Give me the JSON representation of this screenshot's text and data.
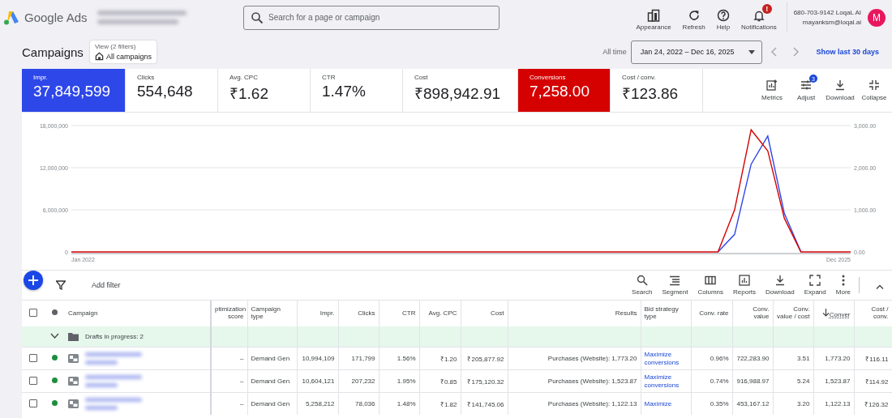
{
  "header": {
    "product": "Google Ads",
    "search": {
      "placeholder": "Search for a page or campaign"
    },
    "tools": [
      {
        "kind": "appearance",
        "label": "Appearance"
      },
      {
        "kind": "refresh",
        "label": "Refresh"
      },
      {
        "kind": "help",
        "label": "Help"
      },
      {
        "kind": "notifications",
        "label": "Notifications",
        "badge": "!"
      }
    ],
    "account": {
      "line1": "680-703-9142 LoqaL AI",
      "line2": "mayanksm@loqal.ai",
      "avatar": "M"
    }
  },
  "page": {
    "title": "Campaigns",
    "view": {
      "caption": "View (2 filters)",
      "value": "All campaigns"
    },
    "date": {
      "preset": "All time",
      "range": "Jan 24, 2022 – Dec 16, 2025",
      "link": "Show last 30 days"
    }
  },
  "metrics": [
    {
      "label": "Impr.",
      "value": "37,849,599",
      "selected": true,
      "color": "#2e47e8"
    },
    {
      "label": "Clicks",
      "value": "554,648",
      "selected": false
    },
    {
      "label": "Avg. CPC",
      "value": "₹1.62",
      "selected": false
    },
    {
      "label": "CTR",
      "value": "1.47%",
      "selected": false
    },
    {
      "label": "Cost",
      "value": "₹898,942.91",
      "selected": false
    },
    {
      "label": "Conversions",
      "value": "7,258.00",
      "selected": true,
      "color": "#d50000"
    },
    {
      "label": "Cost / conv.",
      "value": "₹123.86",
      "selected": false
    }
  ],
  "metric_tools": [
    {
      "kind": "metrics",
      "label": "Metrics"
    },
    {
      "kind": "adjust",
      "label": "Adjust",
      "badge": "3"
    },
    {
      "kind": "download",
      "label": "Download"
    },
    {
      "kind": "collapse",
      "label": "Collapse"
    }
  ],
  "chart_data": {
    "type": "line",
    "ylim": [
      0,
      18000000
    ],
    "y2lim": [
      0,
      3000
    ],
    "yticks": [
      {
        "value": 0,
        "label": "0"
      },
      {
        "value": 6000000,
        "label": "6,000,000"
      },
      {
        "value": 12000000,
        "label": "12,000,000"
      },
      {
        "value": 18000000,
        "label": "18,000,000"
      }
    ],
    "y2ticks": [
      {
        "value": 0,
        "label": "0.00"
      },
      {
        "value": 1000,
        "label": "1,000.00"
      },
      {
        "value": 2000,
        "label": "2,000.00"
      },
      {
        "value": 3000,
        "label": "3,000.00"
      }
    ],
    "series": [
      {
        "color": "#2e47e8",
        "values": [
          null,
          null,
          null,
          null,
          null,
          null,
          null,
          null,
          null,
          null,
          null,
          null,
          null,
          null,
          null,
          null,
          null,
          null,
          null,
          null,
          null,
          null,
          null,
          null,
          null,
          null,
          null,
          null,
          null,
          null,
          null,
          null,
          null,
          null,
          null,
          null,
          null,
          null,
          null,
          0,
          2500000,
          12500000,
          16500000,
          5500000,
          0,
          null,
          null,
          null
        ]
      },
      {
        "color": "#d50000",
        "axis": "y2",
        "values": [
          0,
          0,
          0,
          0,
          0,
          0,
          0,
          0,
          0,
          0,
          0,
          0,
          0,
          0,
          0,
          0,
          0,
          0,
          0,
          0,
          0,
          0,
          0,
          0,
          0,
          0,
          0,
          0,
          0,
          0,
          0,
          0,
          0,
          0,
          0,
          0,
          0,
          0,
          0,
          0,
          1000,
          2900,
          2400,
          800,
          0,
          0,
          0,
          0
        ]
      }
    ]
  },
  "chart_axis_dates": [
    "Jan 2022",
    "Dec 2025"
  ],
  "toolbar": {
    "filter": "Add filter",
    "actions": [
      {
        "kind": "search",
        "label": "Search"
      },
      {
        "kind": "segment",
        "label": "Segment"
      },
      {
        "kind": "columns",
        "label": "Columns"
      },
      {
        "kind": "reports",
        "label": "Reports"
      },
      {
        "kind": "download",
        "label": "Download"
      },
      {
        "kind": "expand",
        "label": "Expand"
      },
      {
        "kind": "more",
        "label": "More"
      }
    ]
  },
  "table": {
    "header_checked": false,
    "columns": [
      {
        "label": "Campaign",
        "kind": "text",
        "sorted": false
      },
      {
        "label": "ptimization score",
        "kind": "number",
        "sorted": false
      },
      {
        "label": "Campaign type",
        "kind": "text",
        "sorted": false
      },
      {
        "label": "Impr.",
        "kind": "number",
        "sorted": false
      },
      {
        "label": "Clicks",
        "kind": "number",
        "sorted": false
      },
      {
        "label": "CTR",
        "kind": "number",
        "sorted": false
      },
      {
        "label": "Avg. CPC",
        "kind": "number",
        "sorted": false
      },
      {
        "label": "Cost",
        "kind": "number",
        "sorted": false
      },
      {
        "label": "Results",
        "kind": "number",
        "sorted": false
      },
      {
        "label": "Bid strategy type",
        "kind": "link",
        "sorted": false
      },
      {
        "label": "Conv. rate",
        "kind": "number",
        "sorted": false
      },
      {
        "label": "Conv. value",
        "kind": "number",
        "sorted": false
      },
      {
        "label": "Conv. value / cost",
        "kind": "number",
        "sorted": false
      },
      {
        "label": "Conver",
        "kind": "number",
        "sorted": true
      },
      {
        "label": "Cost / conv.",
        "kind": "number",
        "sorted": false
      }
    ],
    "group": {
      "label": "Drafts in progress: 2",
      "expanded": true
    },
    "rows": [
      {
        "checked": false,
        "color": "#1e8e3e",
        "cells": [
          "",
          "–",
          "Demand Gen",
          "10,994,109",
          "171,799",
          "1.56%",
          "₹1.20",
          "₹205,877.92",
          "Purchases (Website): 1,773.20",
          "Maximize conversions",
          "0.96%",
          "722,283.90",
          "3.51",
          "1,773.20",
          "₹116.11"
        ]
      },
      {
        "checked": false,
        "color": "#1e8e3e",
        "cells": [
          "",
          "–",
          "Demand Gen",
          "10,604,121",
          "207,232",
          "1.95%",
          "₹0.85",
          "₹175,120.32",
          "Purchases (Website): 1,523.87",
          "Maximize conversions",
          "0.74%",
          "916,988.97",
          "5.24",
          "1,523.87",
          "₹114.92"
        ]
      },
      {
        "checked": false,
        "color": "#1e8e3e",
        "cells": [
          "",
          "–",
          "Demand Gen",
          "5,258,212",
          "78,036",
          "1.48%",
          "₹1.82",
          "₹141,745.06",
          "Purchases (Website): 1,122.13",
          "Maximize",
          "0.35%",
          "453,167.12",
          "3.20",
          "1,122.13",
          "₹126.32"
        ]
      }
    ]
  }
}
